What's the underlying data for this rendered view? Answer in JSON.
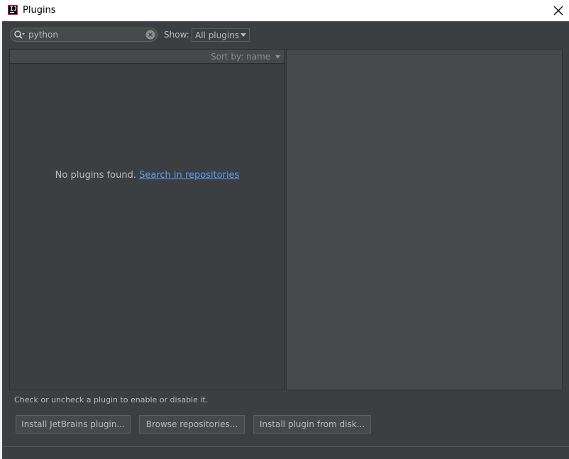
{
  "window": {
    "title": "Plugins"
  },
  "search": {
    "value": "python",
    "placeholder": ""
  },
  "filter": {
    "show_label": "Show:",
    "selected": "All plugins"
  },
  "list": {
    "sort_label": "Sort by: name",
    "empty_text": "No plugins found.",
    "search_repos_link": "Search in repositories"
  },
  "hint": "Check or uncheck a plugin to enable or disable it.",
  "buttons": {
    "install_jetbrains": "Install JetBrains plugin...",
    "browse_repos": "Browse repositories...",
    "install_disk": "Install plugin from disk..."
  },
  "icons": {
    "app": "intellij-app-icon",
    "close": "close-icon",
    "search": "search-icon",
    "clear": "clear-icon",
    "dropdown": "chevron-down-icon"
  },
  "colors": {
    "background": "#3c3f41",
    "panel": "#45494a",
    "link": "#589df6",
    "text": "#bbbbbb"
  }
}
